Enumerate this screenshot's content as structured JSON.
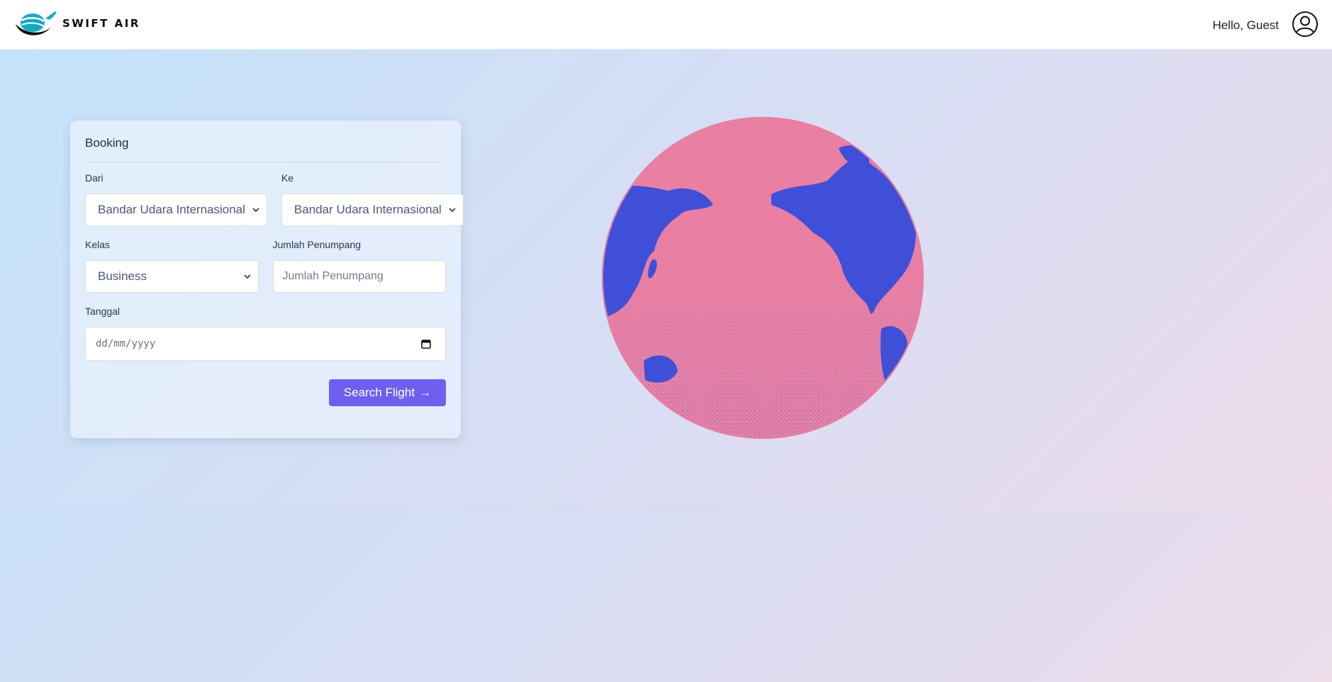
{
  "brand": {
    "name": "SWIFT AIR",
    "logo_icon": "plane-globe-icon"
  },
  "header": {
    "greeting": "Hello, Guest",
    "user_icon": "user-circle-icon"
  },
  "booking": {
    "title": "Booking",
    "from": {
      "label": "Dari",
      "value": "Bandar Udara Internasional"
    },
    "to": {
      "label": "Ke",
      "value": "Bandar Udara Internasional"
    },
    "class": {
      "label": "Kelas",
      "value": "Business"
    },
    "passengers": {
      "label": "Jumlah Penumpang",
      "placeholder": "Jumlah Penumpang"
    },
    "date": {
      "label": "Tanggal",
      "placeholder": "dd/mm/yyyy"
    },
    "search_button": "Search Flight",
    "search_arrow": "→"
  },
  "colors": {
    "accent": "#6f5ef0",
    "globe_ocean": "#e97fa2",
    "globe_land": "#3f4fd8"
  }
}
